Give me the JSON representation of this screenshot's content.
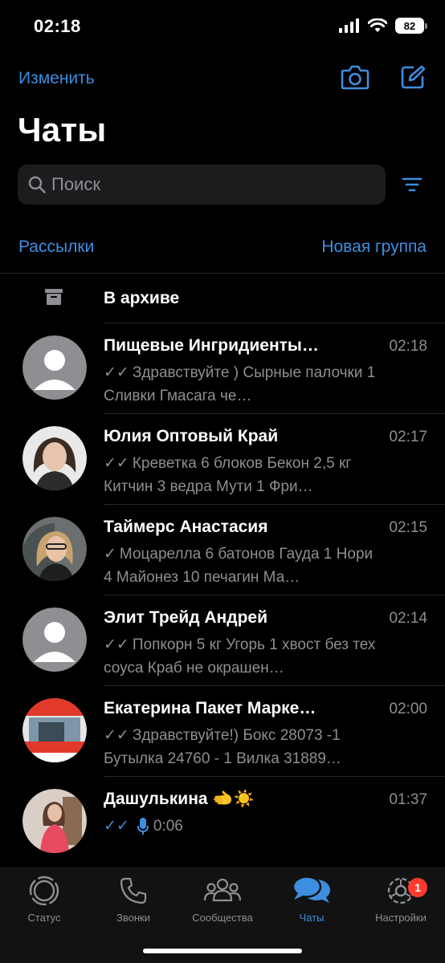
{
  "status_bar": {
    "time": "02:18",
    "battery": "82"
  },
  "header": {
    "edit_label": "Изменить",
    "title": "Чаты"
  },
  "search": {
    "placeholder": "Поиск"
  },
  "links": {
    "broadcasts": "Рассылки",
    "new_group": "Новая группа"
  },
  "archive": {
    "label": "В архиве"
  },
  "chats": [
    {
      "name": "Пищевые Ингридиенты…",
      "time": "02:18",
      "preview": "Здравствуйте ) Сырные палочки 1 Сливки Гмасага че…",
      "tick": "double"
    },
    {
      "name": "Юлия Оптовый Край",
      "time": "02:17",
      "preview": "Креветка 6 блоков Бекон 2,5 кг Китчин 3 ведра Мути 1 Фри…",
      "tick": "double"
    },
    {
      "name": "Таймерс Анастасия",
      "time": "02:15",
      "preview": "Моцарелла 6 батонов Гауда 1 Нори 4 Майонез 10 печагин Ма…",
      "tick": "single"
    },
    {
      "name": "Элит Трейд Андрей",
      "time": "02:14",
      "preview": "Попкорн 5 кг Угорь 1 хвост без тех соуса Краб не окрашен…",
      "tick": "double"
    },
    {
      "name": "Екатерина Пакет Марке…",
      "time": "02:00",
      "preview": "Здравствуйте!) Бокс 28073 -1 Бутылка 24760 - 1 Вилка 31889…",
      "tick": "double"
    },
    {
      "name": "Дашулькина 🫲☀️",
      "time": "01:37",
      "preview": "0:06",
      "tick": "double-blue",
      "voice": true
    }
  ],
  "tabs": [
    {
      "label": "Статус",
      "icon": "status-icon",
      "active": false
    },
    {
      "label": "Звонки",
      "icon": "phone-icon",
      "active": false
    },
    {
      "label": "Сообщества",
      "icon": "communities-icon",
      "active": false
    },
    {
      "label": "Чаты",
      "icon": "chats-icon",
      "active": true
    },
    {
      "label": "Настройки",
      "icon": "settings-icon",
      "active": false,
      "badge": "1"
    }
  ],
  "colors": {
    "accent": "#3e8ee0",
    "badge": "#ff3b30",
    "muted": "#8e8e93",
    "background": "#000000"
  }
}
